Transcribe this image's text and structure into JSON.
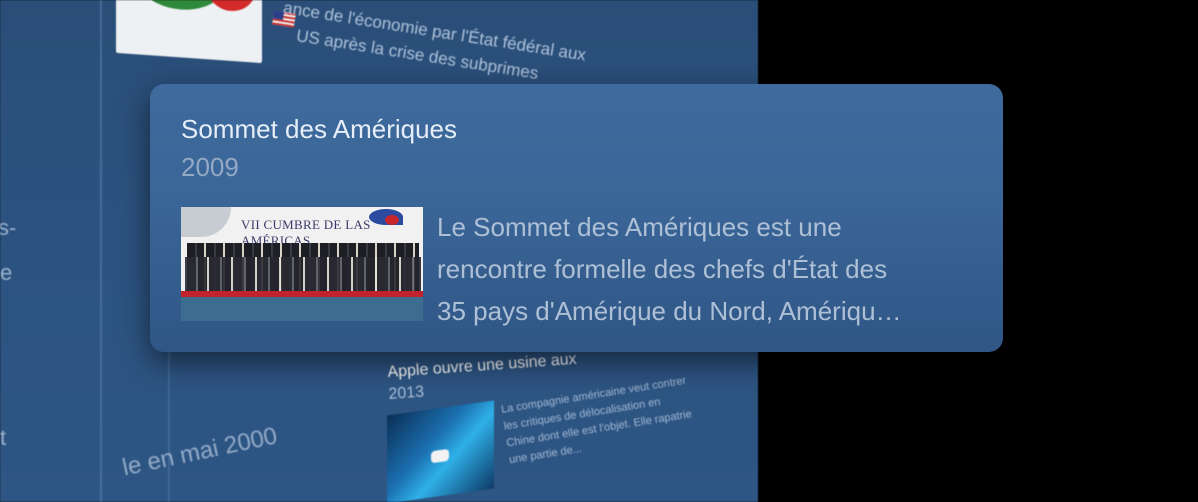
{
  "background": {
    "event_top": {
      "line1": "ance de l'économie par l'État fédéral aux",
      "line2": "US après la crise des subprimes"
    },
    "event_bottom": {
      "title": "Apple ouvre une usine aux",
      "year": "2013",
      "description": "La compagnie américaine veut contrer les critiques de délocalisation en Chine dont elle est l'objet. Elle rapatrie une partie de..."
    },
    "date_label": "le en mai 2000",
    "edge_chars": [
      "s-",
      "e",
      "t"
    ]
  },
  "card": {
    "title": "Sommet des Amériques",
    "year": "2009",
    "thumbnail_banner": "VII CUMBRE DE LAS AMÉRICAS",
    "description_lines": [
      "Le Sommet des Amériques est une",
      "rencontre formelle des chefs d'État des",
      "35 pays d'Amérique du Nord, Amériqu…"
    ]
  },
  "colors": {
    "card_bg": "#3a6597",
    "panel_bg": "#2c5380",
    "title_text": "#e6eef8",
    "secondary_text": "#93a9c4"
  }
}
